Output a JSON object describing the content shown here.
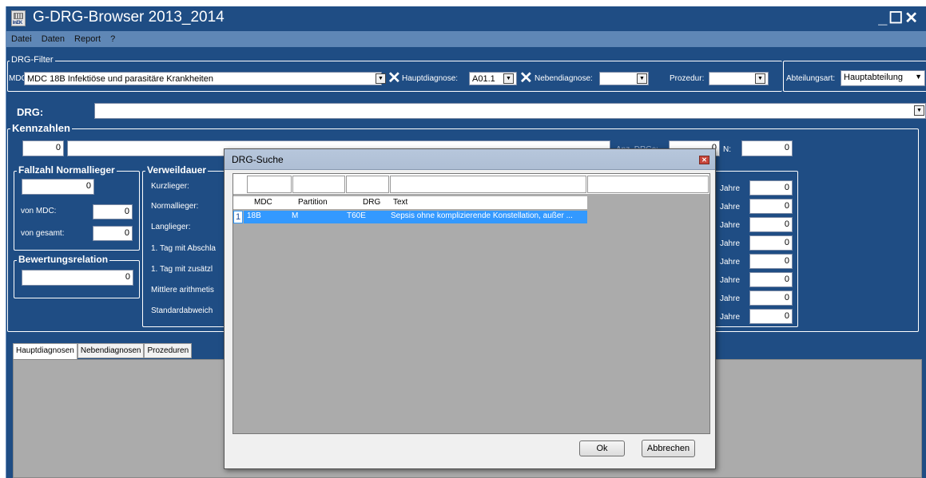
{
  "window": {
    "title": "G-DRG-Browser 2013_2014",
    "logo_text": "InEK",
    "controls": "_☐✕"
  },
  "menu": [
    "Datei",
    "Daten",
    "Report",
    "?"
  ],
  "filter": {
    "group_title": "DRG-Filter",
    "mdc_label": "MDC:",
    "mdc_value": "MDC 18B Infektiöse und parasitäre Krankheiten",
    "hauptdiagnose_label": "Hauptdiagnose:",
    "hauptdiagnose_value": "A01.1",
    "nebendiagnose_label": "Nebendiagnose:",
    "nebendiagnose_value": "",
    "prozedur_label": "Prozedur:",
    "prozedur_value": "",
    "abteilungsart_label": "Abteilungsart:",
    "abteilungsart_value": "Hauptabteilung"
  },
  "drg": {
    "label": "DRG:",
    "value": ""
  },
  "kennzahlen": {
    "title": "Kennzahlen",
    "count_value": "0",
    "anz_drgs_label": "Anz. DRGs:",
    "anz_drgs_value": "0",
    "n_label": "N:",
    "n_value": "0"
  },
  "fallzahl": {
    "title": "Fallzahl Normallieger",
    "total": "0",
    "von_mdc_label": "von MDC:",
    "von_mdc_value": "0",
    "von_gesamt_label": "von gesamt:",
    "von_gesamt_value": "0"
  },
  "bewertung": {
    "title": "Bewertungsrelation",
    "value": "0"
  },
  "verweildauer": {
    "title": "Verweildauer",
    "items": [
      "Kurzlieger:",
      "Normallieger:",
      "Langlieger:",
      "1. Tag mit Abschla",
      "1. Tag mit zusätzl",
      "Mittlere arithmetis",
      "Standardabweich"
    ]
  },
  "jahre": {
    "label": "Jahre",
    "values": [
      "0",
      "0",
      "0",
      "0",
      "0",
      "0",
      "0",
      "0"
    ]
  },
  "tabs": [
    "Hauptdiagnosen",
    "Nebendiagnosen",
    "Prozeduren"
  ],
  "dialog": {
    "title": "DRG-Suche",
    "columns": [
      "MDC",
      "Partition",
      "DRG",
      "Text"
    ],
    "rows": [
      {
        "num": "1",
        "mdc": "18B",
        "partition": "M",
        "drg": "T60E",
        "text": "Sepsis ohne komplizierende Konstellation, außer ..."
      }
    ],
    "ok_label": "Ok",
    "cancel_label": "Abbrechen"
  }
}
